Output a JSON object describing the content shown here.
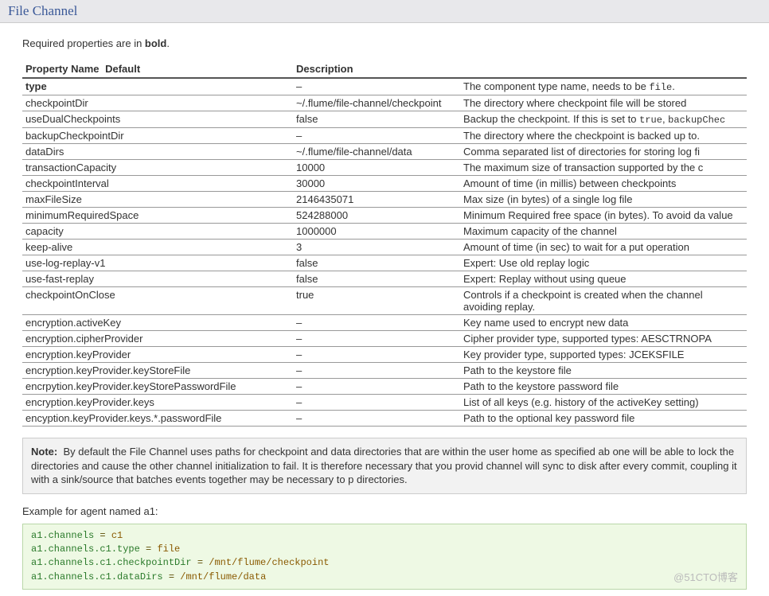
{
  "header": {
    "title": "File Channel"
  },
  "intro": {
    "prefix": "Required properties are in ",
    "bold": "bold",
    "suffix": "."
  },
  "table": {
    "headers": {
      "name": "Property Name",
      "default": "Default",
      "description": "Description"
    },
    "rows": [
      {
        "name": "type",
        "bold": true,
        "default": "–",
        "desc_prefix": "The component type name, needs to be ",
        "desc_tt": "file",
        "desc_suffix": "."
      },
      {
        "name": "checkpointDir",
        "default": "~/.flume/file-channel/checkpoint",
        "desc": "The directory where checkpoint file will be stored"
      },
      {
        "name": "useDualCheckpoints",
        "default": "false",
        "desc_prefix": "Backup the checkpoint. If this is set to ",
        "desc_tt": "true",
        "desc_suffix": ", ",
        "desc_tt2": "backupChec"
      },
      {
        "name": "backupCheckpointDir",
        "default": "–",
        "desc": "The directory where the checkpoint is backed up to."
      },
      {
        "name": "dataDirs",
        "default": "~/.flume/file-channel/data",
        "desc": "Comma separated list of directories for storing log fi"
      },
      {
        "name": "transactionCapacity",
        "default": "10000",
        "desc": "The maximum size of transaction supported by the c"
      },
      {
        "name": "checkpointInterval",
        "default": "30000",
        "desc": "Amount of time (in millis) between checkpoints"
      },
      {
        "name": "maxFileSize",
        "default": "2146435071",
        "desc": "Max size (in bytes) of a single log file"
      },
      {
        "name": "minimumRequiredSpace",
        "default": "524288000",
        "desc": "Minimum Required free space (in bytes). To avoid da value"
      },
      {
        "name": "capacity",
        "default": "1000000",
        "desc": "Maximum capacity of the channel"
      },
      {
        "name": "keep-alive",
        "default": "3",
        "desc": "Amount of time (in sec) to wait for a put operation"
      },
      {
        "name": "use-log-replay-v1",
        "default": "false",
        "desc": "Expert: Use old replay logic"
      },
      {
        "name": "use-fast-replay",
        "default": "false",
        "desc": "Expert: Replay without using queue"
      },
      {
        "name": "checkpointOnClose",
        "default": "true",
        "desc": "Controls if a checkpoint is created when the channel avoiding replay."
      },
      {
        "name": "encryption.activeKey",
        "default": "–",
        "desc": "Key name used to encrypt new data"
      },
      {
        "name": "encryption.cipherProvider",
        "default": "–",
        "desc": "Cipher provider type, supported types: AESCTRNOPA"
      },
      {
        "name": "encryption.keyProvider",
        "default": "–",
        "desc": "Key provider type, supported types: JCEKSFILE"
      },
      {
        "name": "encryption.keyProvider.keyStoreFile",
        "default": "–",
        "desc": "Path to the keystore file"
      },
      {
        "name": "encrpytion.keyProvider.keyStorePasswordFile",
        "default": "–",
        "desc": "Path to the keystore password file"
      },
      {
        "name": "encryption.keyProvider.keys",
        "default": "–",
        "desc": "List of all keys (e.g. history of the activeKey setting)"
      },
      {
        "name": "encyption.keyProvider.keys.*.passwordFile",
        "default": "–",
        "desc": "Path to the optional key password file"
      }
    ]
  },
  "note": {
    "label": "Note:",
    "text": "By default the File Channel uses paths for checkpoint and data directories that are within the user home as specified ab one will be able to lock the directories and cause the other channel initialization to fail. It is therefore necessary that you provid channel will sync to disk after every commit, coupling it with a sink/source that batches events together may be necessary to p directories."
  },
  "example": {
    "label": "Example for agent named a1:",
    "lines": [
      {
        "key": "a1.channels",
        "eq": " = ",
        "val": "c1"
      },
      {
        "key": "a1.channels.c1.type",
        "eq": " = ",
        "val": "file"
      },
      {
        "key": "a1.channels.c1.checkpointDir",
        "eq": " = ",
        "val": "/mnt/flume/checkpoint"
      },
      {
        "key": "a1.channels.c1.dataDirs",
        "eq": " = ",
        "val": "/mnt/flume/data"
      }
    ]
  },
  "watermark": "@51CTO博客"
}
